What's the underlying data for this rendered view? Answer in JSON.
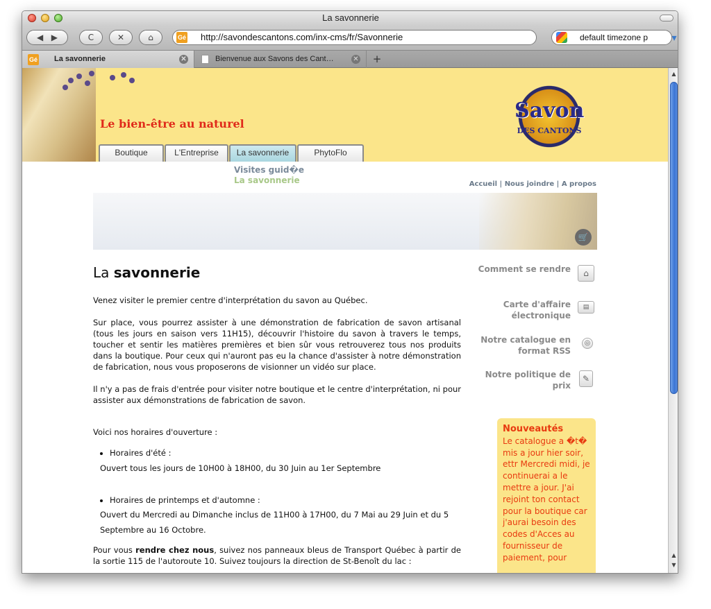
{
  "window": {
    "title": "La savonnerie"
  },
  "toolbar": {
    "url": "http://savondescantons.com/inx-cms/fr/Savonnerie",
    "search_value": "default timezone p",
    "favicon_text": "Gé"
  },
  "tabs": [
    {
      "label": "La savonnerie",
      "active": true
    },
    {
      "label": "Bienvenue aux Savons des Cant…",
      "active": false
    }
  ],
  "site": {
    "tagline": "Le bien-être au naturel",
    "logo_top": "Savon",
    "logo_bottom": "DES CANTONS",
    "nav": [
      "Boutique",
      "L'Entreprise",
      "La savonnerie",
      "PhytoFlo"
    ],
    "submenu": [
      "Visites guid�e",
      "La savonnerie"
    ],
    "toplinks": [
      "Accueil",
      "Nous joindre",
      "A propos"
    ],
    "toplinks_sep": " | "
  },
  "article": {
    "title_prefix": "La ",
    "title_bold": "savonnerie",
    "p1": "Venez visiter le premier centre d'interprétation du savon au Québec.",
    "p2": "Sur place, vous pourrez assister à une démonstration de fabrication de savon artisanal (tous les jours en saison vers 11H15), découvrir l'histoire du savon à travers le temps, toucher et sentir les matières premières et bien sûr vous retrouverez tous nos produits dans la boutique. Pour ceux qui n'auront pas eu la chance d'assister à notre démonstration de fabrication, nous vous proposerons de visionner un vidéo sur place.",
    "p3": "Il n'y a pas de frais d'entrée pour visiter notre boutique et le centre d'interprétation, ni pour assister aux démonstrations de fabrication de savon.",
    "hours_intro": "Voici nos horaires d'ouverture :",
    "schedules": [
      {
        "title": "Horaires d'été :",
        "text": "Ouvert tous les jours de 10H00 à 18H00, du 30 Juin au 1er Septembre"
      },
      {
        "title": "Horaires de printemps et d'automne :",
        "text": "Ouvert du Mercredi au Dimanche inclus de 11H00 à 17H00, du 7 Mai au 29 Juin et du 5 Septembre au 16 Octobre."
      }
    ],
    "p4_pre": "Pour vous ",
    "p4_bold": "rendre chez nous",
    "p4_post": ", suivez nos panneaux bleus de Transport Québec à partir de la sortie 115 de l'autoroute 10. Suivez toujours la direction de St-Benoît du lac :"
  },
  "sidebar": [
    {
      "label": "Comment se rendre",
      "icon": "map-icon"
    },
    {
      "label": "Carte d'affaire électronique",
      "icon": "vcard-icon"
    },
    {
      "label": "Notre catalogue en format RSS",
      "icon": "rss-icon"
    },
    {
      "label": "Notre politique de prix",
      "icon": "price-icon"
    }
  ],
  "news": {
    "title": "Nouveautés",
    "text": "Le catalogue a �t� mis a jour hier soir, ettr Mercredi midi, je continuerai a le mettre a jour. J'ai rejoint ton contact pour la boutique car j'aurai besoin des codes d'Acces au fournisseur de paiement, pour"
  }
}
